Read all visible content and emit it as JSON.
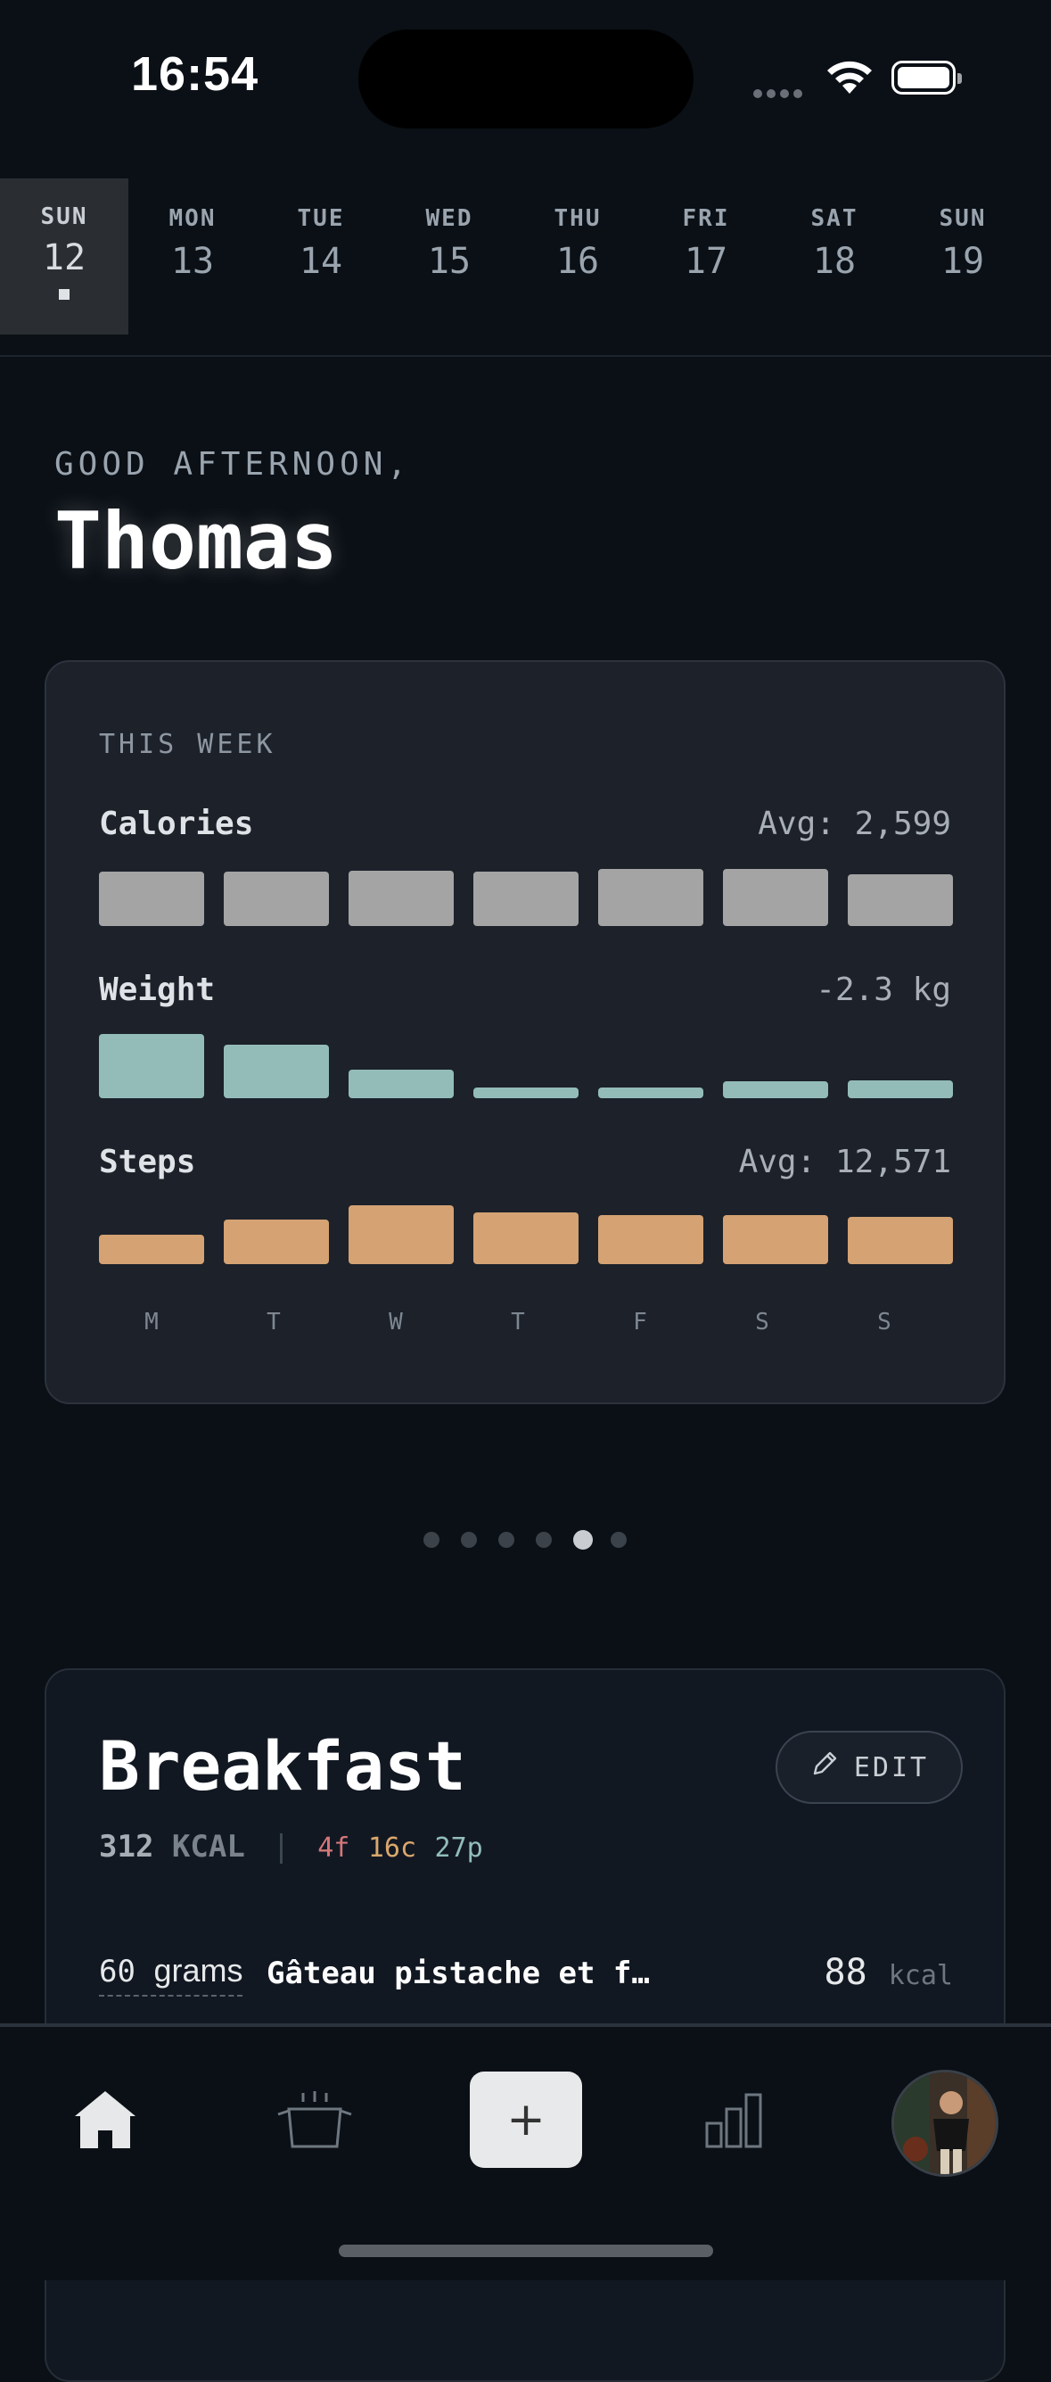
{
  "status_bar": {
    "time": "16:54"
  },
  "week_strip": {
    "days": [
      {
        "name": "SUN",
        "num": "12",
        "active": true
      },
      {
        "name": "MON",
        "num": "13"
      },
      {
        "name": "TUE",
        "num": "14"
      },
      {
        "name": "WED",
        "num": "15"
      },
      {
        "name": "THU",
        "num": "16"
      },
      {
        "name": "FRI",
        "num": "17"
      },
      {
        "name": "SAT",
        "num": "18"
      },
      {
        "name": "SUN",
        "num": "19"
      }
    ]
  },
  "greeting": {
    "salutation": "GOOD AFTERNOON,",
    "name": "Thomas"
  },
  "week_card": {
    "label": "THIS WEEK",
    "calories": {
      "label": "Calories",
      "summary": "Avg: 2,599",
      "color": "#a4a4a4"
    },
    "weight": {
      "label": "Weight",
      "summary": "-2.3 kg",
      "color": "#93bcb9"
    },
    "steps": {
      "label": "Steps",
      "summary": "Avg: 12,571",
      "color": "#d4a273"
    },
    "day_letters": [
      "M",
      "T",
      "W",
      "T",
      "F",
      "S",
      "S"
    ]
  },
  "chart_data": [
    {
      "type": "bar",
      "title": "Calories",
      "categories": [
        "M",
        "T",
        "W",
        "T",
        "F",
        "S",
        "S"
      ],
      "values": [
        0.9,
        0.89,
        0.91,
        0.89,
        0.94,
        0.94,
        0.85
      ]
    },
    {
      "type": "bar",
      "title": "Weight",
      "categories": [
        "M",
        "T",
        "W",
        "T",
        "F",
        "S",
        "S"
      ],
      "values": [
        1.0,
        0.83,
        0.45,
        0.16,
        0.16,
        0.26,
        0.28
      ]
    },
    {
      "type": "bar",
      "title": "Steps",
      "categories": [
        "M",
        "T",
        "W",
        "T",
        "F",
        "S",
        "S"
      ],
      "values": [
        0.5,
        0.76,
        1.0,
        0.88,
        0.83,
        0.83,
        0.81
      ]
    }
  ],
  "pager": {
    "count": 6,
    "active_index": 4
  },
  "meal": {
    "title": "Breakfast",
    "edit_label": "EDIT",
    "kcal": "312",
    "kcal_unit": "KCAL",
    "fat": "4f",
    "carbs": "16c",
    "protein": "27p",
    "items": [
      {
        "qty": "60",
        "qty_unit": "grams",
        "name": "Gâteau pistache et fruits rouges",
        "kcal": "88",
        "kcal_unit": "kcal"
      }
    ]
  },
  "tab_bar": {
    "tabs": [
      "home-icon",
      "pot-icon",
      "add-icon",
      "stats-icon",
      "profile-avatar"
    ],
    "add_label": "+"
  }
}
